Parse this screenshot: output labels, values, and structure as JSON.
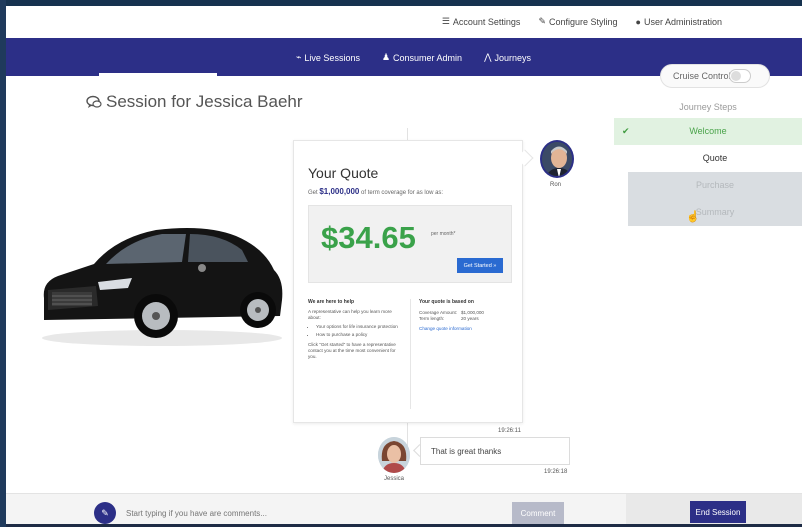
{
  "header": {
    "links": [
      {
        "icon": "sliders-icon",
        "label": "Account Settings"
      },
      {
        "icon": "pencil-icon",
        "label": "Configure Styling"
      },
      {
        "icon": "user-icon",
        "label": "User Administration"
      }
    ]
  },
  "nav": {
    "items": [
      {
        "icon": "live-icon",
        "label": "Live Sessions"
      },
      {
        "icon": "users-icon",
        "label": "Consumer Admin"
      },
      {
        "icon": "road-icon",
        "label": "Journeys"
      }
    ]
  },
  "session": {
    "title": "Session for Jessica Baehr",
    "icon": "chat-bubbles-icon"
  },
  "cruise_control": {
    "label": "Cruise Control",
    "enabled": false
  },
  "journey": {
    "heading": "Journey Steps",
    "steps": [
      {
        "label": "Welcome",
        "state": "done"
      },
      {
        "label": "Quote",
        "state": "active"
      },
      {
        "label": "Purchase",
        "state": "disabled"
      },
      {
        "label": "Summary",
        "state": "disabled"
      }
    ]
  },
  "quote": {
    "title": "Your Quote",
    "subtitle_pre": "Get ",
    "subtitle_amount": "$1,000,000",
    "subtitle_post": " of term coverage for as low as:",
    "price": "$34.65",
    "per": "per month*",
    "cta": "Get Started »",
    "help_heading": "We are here to help",
    "help_intro": "A representative can help you learn more about:",
    "help_items": [
      "Your options for life insurance protection",
      "How to purchase a policy"
    ],
    "help_outro": "Click \"Get started\" to have a representative contact you at the time most convenient for you.",
    "based_heading": "Your quote is based on",
    "based_rows": [
      {
        "label": "Coverage Amount:",
        "value": "$1,000,000"
      },
      {
        "label": "Term length:",
        "value": "20 years"
      }
    ],
    "change_link": "Change quote information"
  },
  "agent": {
    "name": "Ron"
  },
  "customer": {
    "name": "Jessica"
  },
  "messages": [
    {
      "time": "19:26:11"
    },
    {
      "text": "That is great thanks",
      "time": "19:26:18"
    }
  ],
  "composer": {
    "placeholder": "Start typing if you have are comments...",
    "comment_label": "Comment",
    "end_label": "End Session"
  },
  "colors": {
    "nav": "#2c2f87",
    "price": "#3aa24a",
    "cta": "#2a6ad1",
    "done": "#e1f2e1"
  }
}
